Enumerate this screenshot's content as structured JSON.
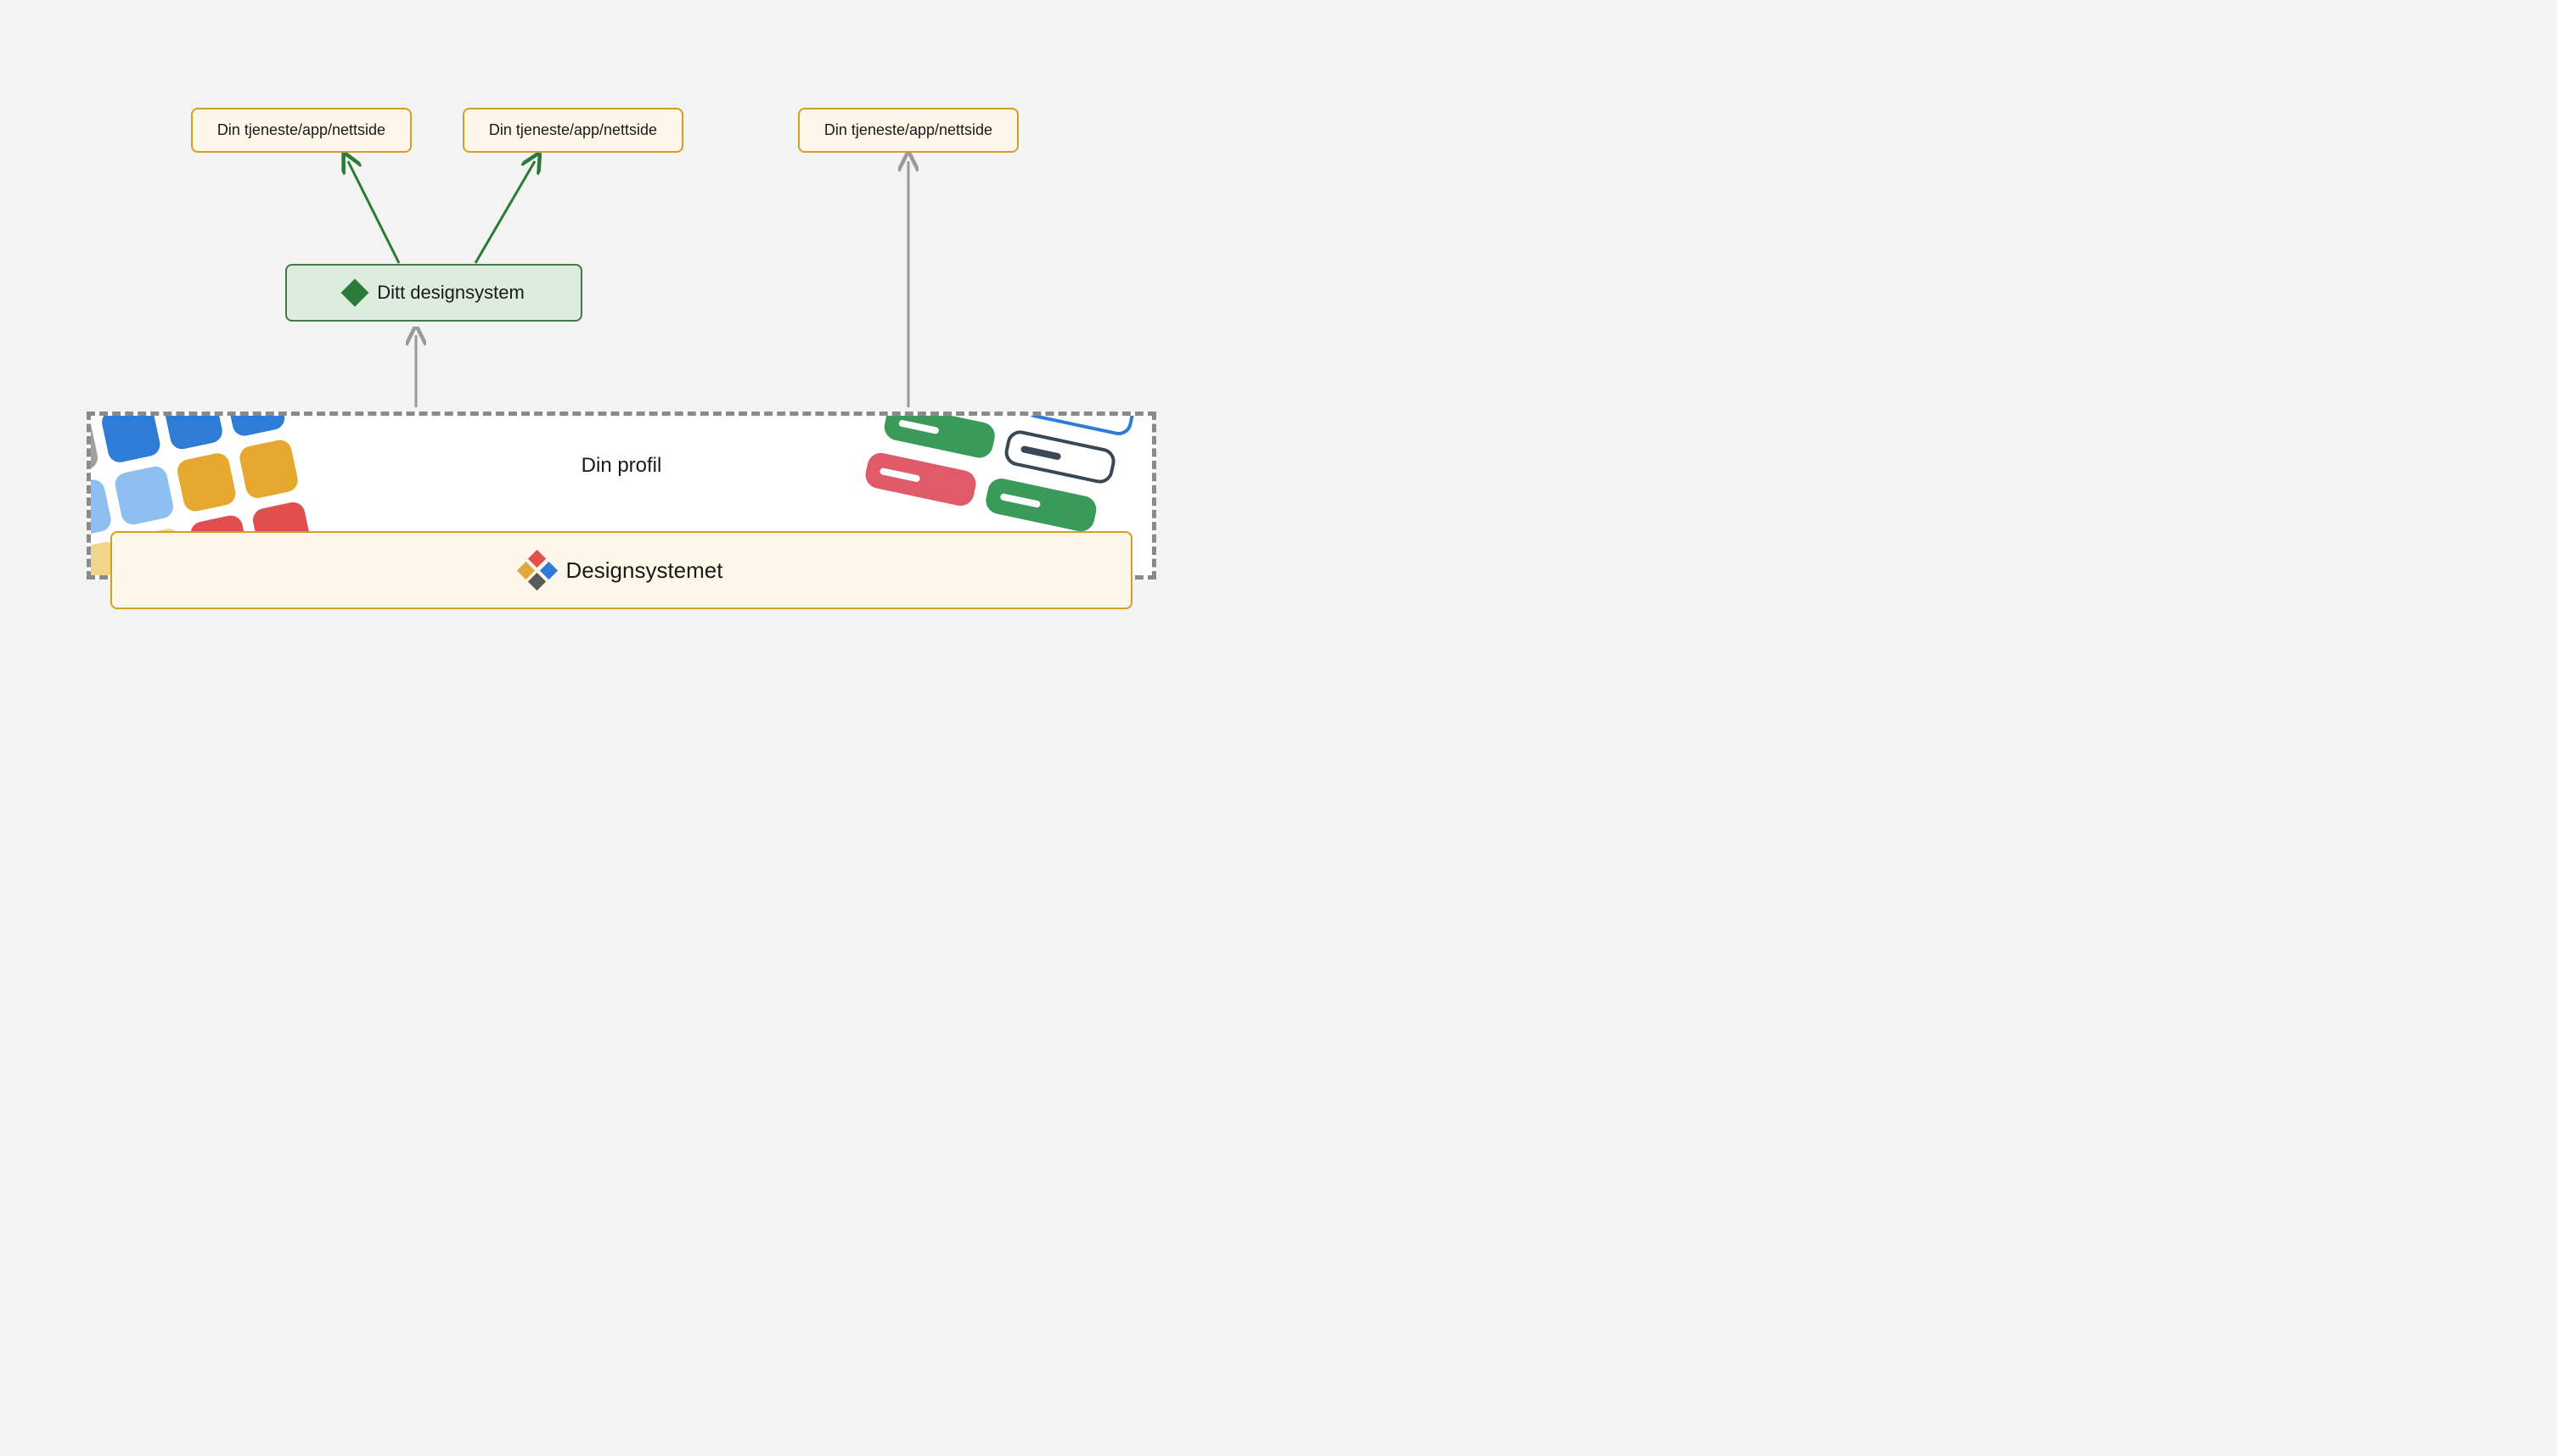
{
  "nodes": {
    "service1": "Din tjeneste/app/nettside",
    "service2": "Din tjeneste/app/nettside",
    "service3": "Din tjeneste/app/nettside",
    "your_designsystem": "Ditt designsystem",
    "your_profile": "Din profil",
    "designsystemet": "Designsystemet"
  },
  "colors": {
    "yellow_border": "#d4a020",
    "yellow_bg": "#fdf7e9",
    "green_border": "#3f7a47",
    "green_bg": "#dceddd",
    "arrow_gray": "#9a9a9a",
    "arrow_green": "#2a7a3a",
    "dash_gray": "#8a8a8a"
  },
  "swatches_left": {
    "row1": [
      "#a0a0a0",
      "#2e7cd6",
      "#2e7cd6",
      "#2e7cd6"
    ],
    "row2": [
      "#8dbff0",
      "#8dbff0",
      "#e6a82e",
      "#e6a82e"
    ],
    "row3": [
      "#f0d68a",
      "#f0d68a",
      "#e04e4e",
      "#e04e4e"
    ]
  },
  "pills_right": [
    {
      "type": "solid",
      "color": "#3a4754"
    },
    {
      "type": "outline",
      "color": "#2e7cd6"
    },
    {
      "type": "solid",
      "color": "#3a9a5a"
    },
    {
      "type": "outline",
      "color": "#3a4754"
    },
    {
      "type": "solid",
      "color": "#e05a6a"
    },
    {
      "type": "solid",
      "color": "#3a9a5a"
    }
  ]
}
